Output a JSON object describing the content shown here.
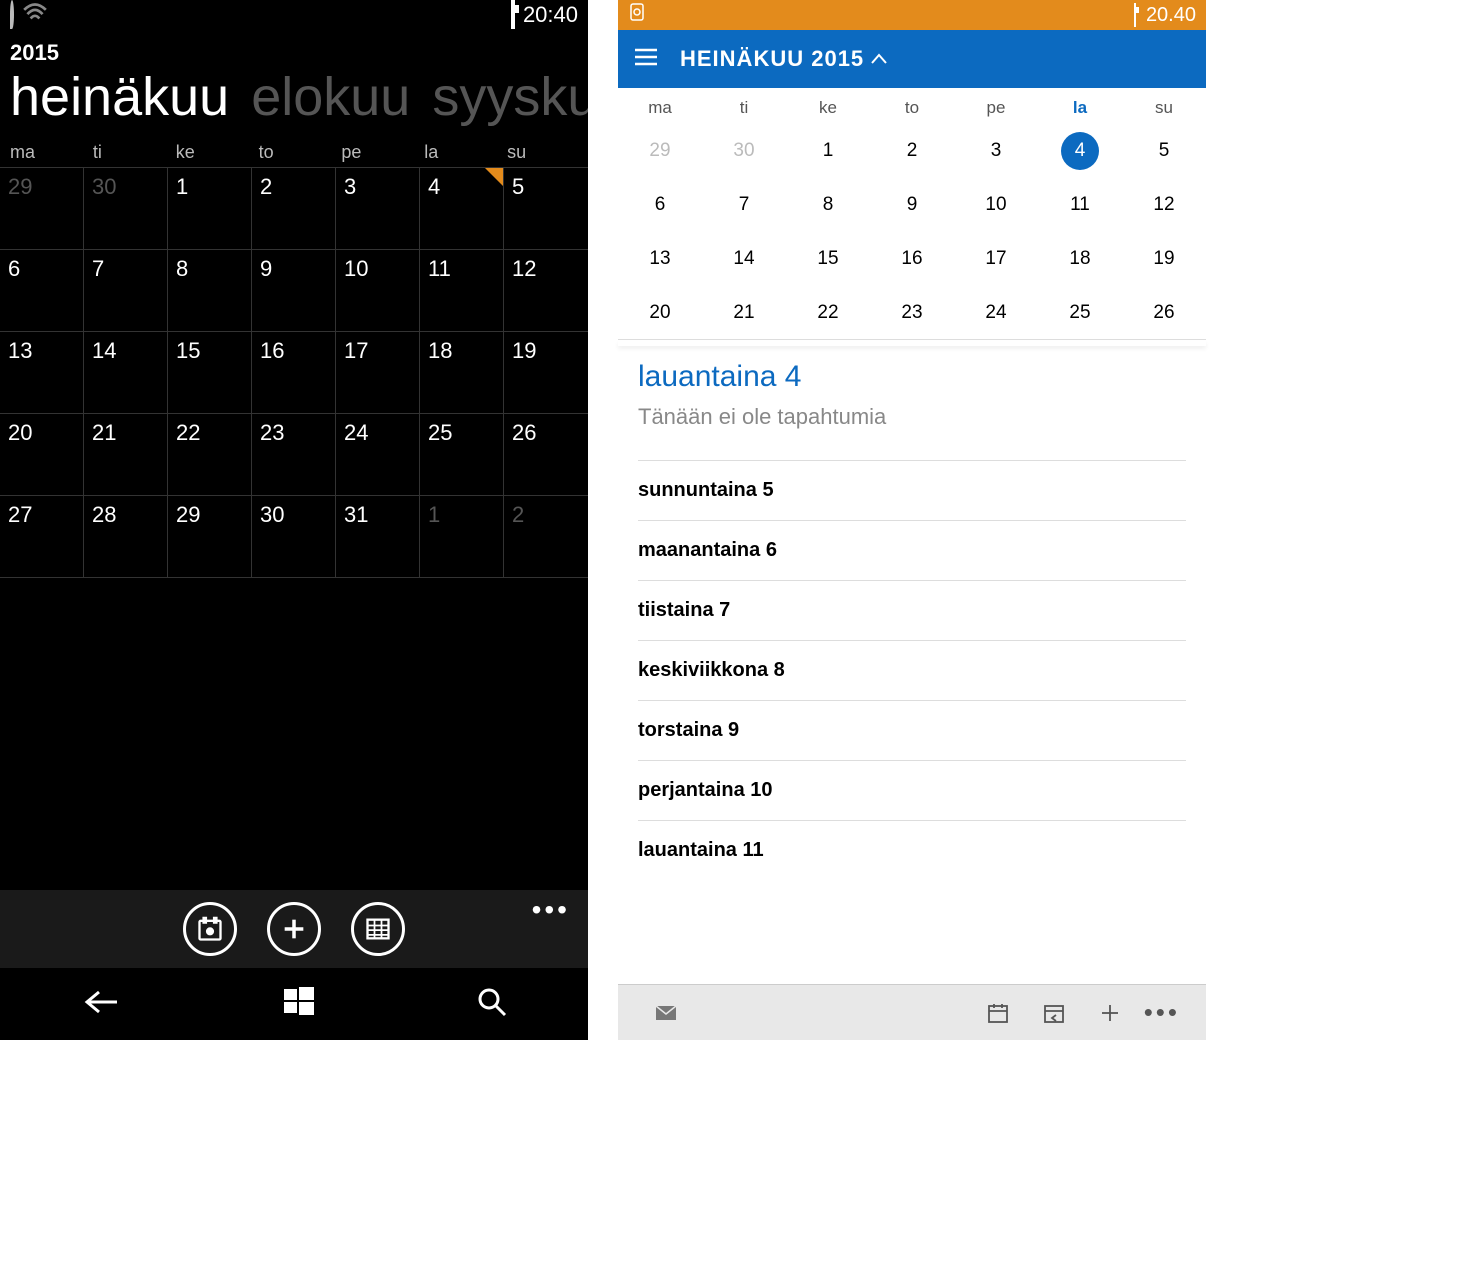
{
  "left": {
    "status": {
      "time": "20:40"
    },
    "year": "2015",
    "months": {
      "current": "heinäkuu",
      "next1": "elokuu",
      "next2": "syyskuu"
    },
    "weekdays": [
      "ma",
      "ti",
      "ke",
      "to",
      "pe",
      "la",
      "su"
    ],
    "grid": [
      {
        "d": "29",
        "dim": true
      },
      {
        "d": "30",
        "dim": true
      },
      {
        "d": "1"
      },
      {
        "d": "2"
      },
      {
        "d": "3"
      },
      {
        "d": "4",
        "mark": true
      },
      {
        "d": "5"
      },
      {
        "d": "6"
      },
      {
        "d": "7"
      },
      {
        "d": "8"
      },
      {
        "d": "9"
      },
      {
        "d": "10"
      },
      {
        "d": "11"
      },
      {
        "d": "12"
      },
      {
        "d": "13"
      },
      {
        "d": "14"
      },
      {
        "d": "15"
      },
      {
        "d": "16"
      },
      {
        "d": "17"
      },
      {
        "d": "18"
      },
      {
        "d": "19"
      },
      {
        "d": "20"
      },
      {
        "d": "21"
      },
      {
        "d": "22"
      },
      {
        "d": "23"
      },
      {
        "d": "24"
      },
      {
        "d": "25"
      },
      {
        "d": "26"
      },
      {
        "d": "27"
      },
      {
        "d": "28"
      },
      {
        "d": "29"
      },
      {
        "d": "30"
      },
      {
        "d": "31"
      },
      {
        "d": "1",
        "dim": true
      },
      {
        "d": "2",
        "dim": true
      }
    ]
  },
  "right": {
    "status": {
      "time": "20.40"
    },
    "header": {
      "title": "HEINÄKUU 2015"
    },
    "weekdays": [
      {
        "l": "ma"
      },
      {
        "l": "ti"
      },
      {
        "l": "ke"
      },
      {
        "l": "to"
      },
      {
        "l": "pe"
      },
      {
        "l": "la",
        "hl": true
      },
      {
        "l": "su"
      }
    ],
    "grid": [
      {
        "d": "29",
        "dim": true
      },
      {
        "d": "30",
        "dim": true
      },
      {
        "d": "1"
      },
      {
        "d": "2"
      },
      {
        "d": "3"
      },
      {
        "d": "4",
        "today": true
      },
      {
        "d": "5"
      },
      {
        "d": "6"
      },
      {
        "d": "7"
      },
      {
        "d": "8"
      },
      {
        "d": "9"
      },
      {
        "d": "10"
      },
      {
        "d": "11"
      },
      {
        "d": "12"
      },
      {
        "d": "13"
      },
      {
        "d": "14"
      },
      {
        "d": "15"
      },
      {
        "d": "16"
      },
      {
        "d": "17"
      },
      {
        "d": "18"
      },
      {
        "d": "19"
      },
      {
        "d": "20"
      },
      {
        "d": "21"
      },
      {
        "d": "22"
      },
      {
        "d": "23"
      },
      {
        "d": "24"
      },
      {
        "d": "25"
      },
      {
        "d": "26"
      }
    ],
    "agenda": {
      "today_label": "lauantaina 4",
      "no_events": "Tänään ei ole tapahtumia",
      "days": [
        "sunnuntaina 5",
        "maanantaina 6",
        "tiistaina 7",
        "keskiviikkona 8",
        "torstaina 9",
        "perjantaina 10",
        "lauantaina 11"
      ]
    }
  },
  "colors": {
    "accent_left": "#e38b1c",
    "accent_right": "#0c6ac0"
  }
}
